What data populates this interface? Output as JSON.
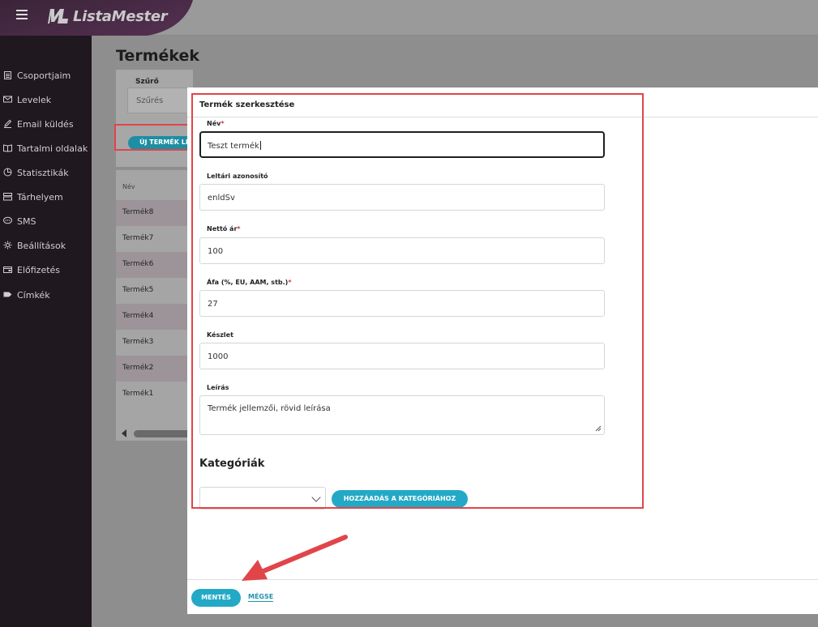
{
  "app": {
    "brand": "ListaMester"
  },
  "sidebar": {
    "items": [
      {
        "label": "Csoportjaim",
        "icon": "clipboard-icon"
      },
      {
        "label": "Levelek",
        "icon": "mail-icon"
      },
      {
        "label": "Email küldés",
        "icon": "pencil-icon"
      },
      {
        "label": "Tartalmi oldalak",
        "icon": "book-icon"
      },
      {
        "label": "Statisztikák",
        "icon": "pie-chart-icon"
      },
      {
        "label": "Tárhelyem",
        "icon": "storage-icon"
      },
      {
        "label": "SMS",
        "icon": "chat-icon"
      },
      {
        "label": "Beállítások",
        "icon": "gear-icon"
      },
      {
        "label": "Előfizetés",
        "icon": "wallet-icon"
      },
      {
        "label": "Címkék",
        "icon": "tag-icon"
      }
    ]
  },
  "page": {
    "title": "Termékek",
    "filter": {
      "label": "Szűrő",
      "placeholder": "Szűrés"
    },
    "new_button": "ÚJ TERMÉK LÉ",
    "list": {
      "header": "Név",
      "rows": [
        "Termék8",
        "Termék7",
        "Termék6",
        "Termék5",
        "Termék4",
        "Termék3",
        "Termék2",
        "Termék1"
      ]
    }
  },
  "modal": {
    "title": "Termék szerkesztése",
    "fields": {
      "name": {
        "label": "Név",
        "required": "*",
        "value": "Teszt termék"
      },
      "sku": {
        "label": "Leltári azonosító",
        "value": "enldSv"
      },
      "net_price": {
        "label": "Nettó ár",
        "required": "*",
        "value": "100"
      },
      "vat": {
        "label": "Áfa (%, EU, AAM, stb.)",
        "required": "*",
        "value": "27"
      },
      "stock": {
        "label": "Készlet",
        "value": "1000"
      },
      "description": {
        "label": "Leírás",
        "value": "Termék jellemzői, rövid leírása"
      }
    },
    "categories": {
      "title": "Kategóriák",
      "select_value": "",
      "add_button": "HOZZÁADÁS A KATEGÓRIÁHOZ"
    },
    "footer": {
      "save": "MENTÉS",
      "cancel": "MÉGSE"
    }
  },
  "colors": {
    "accent": "#23a9c6",
    "highlight": "#e0454a",
    "sidebar_bg": "#1f181e"
  }
}
